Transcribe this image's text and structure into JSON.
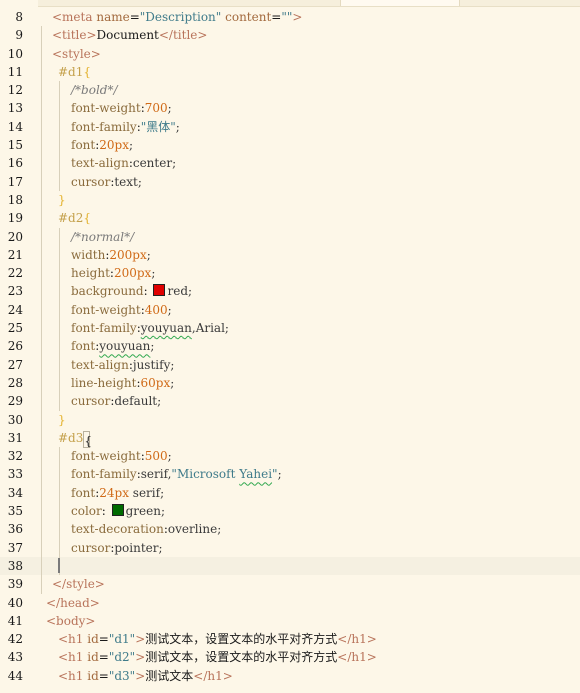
{
  "editor": {
    "lines": [
      {
        "n": "8",
        "code": "<meta name=\"Description\" content=\"\">"
      },
      {
        "n": "9",
        "code": "<title>Document</title>"
      },
      {
        "n": "10",
        "code": "<style>"
      },
      {
        "n": "11",
        "code": "#d1{"
      },
      {
        "n": "12",
        "code": "/*bold*/"
      },
      {
        "n": "13",
        "code": "font-weight:700;"
      },
      {
        "n": "14",
        "code": "font-family:\"黑体\";"
      },
      {
        "n": "15",
        "code": "font:20px;"
      },
      {
        "n": "16",
        "code": "text-align:center;"
      },
      {
        "n": "17",
        "code": "cursor:text;"
      },
      {
        "n": "18",
        "code": "}"
      },
      {
        "n": "19",
        "code": "#d2{"
      },
      {
        "n": "20",
        "code": "/*normal*/"
      },
      {
        "n": "21",
        "code": "width:200px;"
      },
      {
        "n": "22",
        "code": "height:200px;"
      },
      {
        "n": "23",
        "code": "background: red;"
      },
      {
        "n": "24",
        "code": "font-weight:400;"
      },
      {
        "n": "25",
        "code": "font-family:youyuan,Arial;"
      },
      {
        "n": "26",
        "code": "font:youyuan;"
      },
      {
        "n": "27",
        "code": "text-align:justify;"
      },
      {
        "n": "28",
        "code": "line-height:60px;"
      },
      {
        "n": "29",
        "code": "cursor:default;"
      },
      {
        "n": "30",
        "code": "}"
      },
      {
        "n": "31",
        "code": "#d3{"
      },
      {
        "n": "32",
        "code": "font-weight:500;"
      },
      {
        "n": "33",
        "code": "font-family:serif,\"Microsoft Yahei\";"
      },
      {
        "n": "34",
        "code": "font:24px serif;"
      },
      {
        "n": "35",
        "code": "color: green;"
      },
      {
        "n": "36",
        "code": "text-decoration:overline;"
      },
      {
        "n": "37",
        "code": "cursor:pointer;"
      },
      {
        "n": "38",
        "code": ""
      },
      {
        "n": "39",
        "code": "</style>"
      },
      {
        "n": "40",
        "code": "</head>"
      },
      {
        "n": "41",
        "code": "<body>"
      },
      {
        "n": "42",
        "code": "<h1 id=\"d1\">测试文本，设置文本的水平对齐方式</h1>"
      },
      {
        "n": "43",
        "code": "<h1 id=\"d2\">测试文本，设置文本的水平对齐方式</h1>"
      },
      {
        "n": "44",
        "code": "<h1 id=\"d3\">测试文本</h1>"
      }
    ],
    "swatches": {
      "red": "#e00000",
      "green": "#006b00"
    },
    "colors": {
      "background": "#fdf7e8",
      "current_line": "#f5f0e1"
    }
  }
}
